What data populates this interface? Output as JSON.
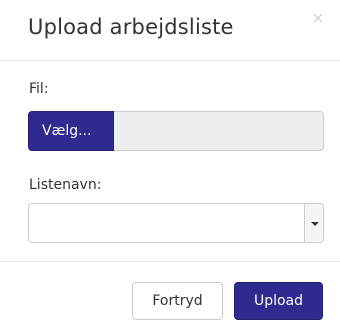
{
  "dialog": {
    "title": "Upload arbejdsliste",
    "close_icon": "close-icon"
  },
  "form": {
    "file_label": "Fil:",
    "file_button_label": "Vælg...",
    "file_name_value": "",
    "list_name_label": "Listenavn:",
    "list_name_value": "",
    "list_name_toggle_icon": "caret-down-icon"
  },
  "footer": {
    "cancel_label": "Fortryd",
    "upload_label": "Upload"
  },
  "colors": {
    "primary": "#2e2a8f",
    "file_display_bg": "#eeeeee",
    "text": "#333333"
  }
}
